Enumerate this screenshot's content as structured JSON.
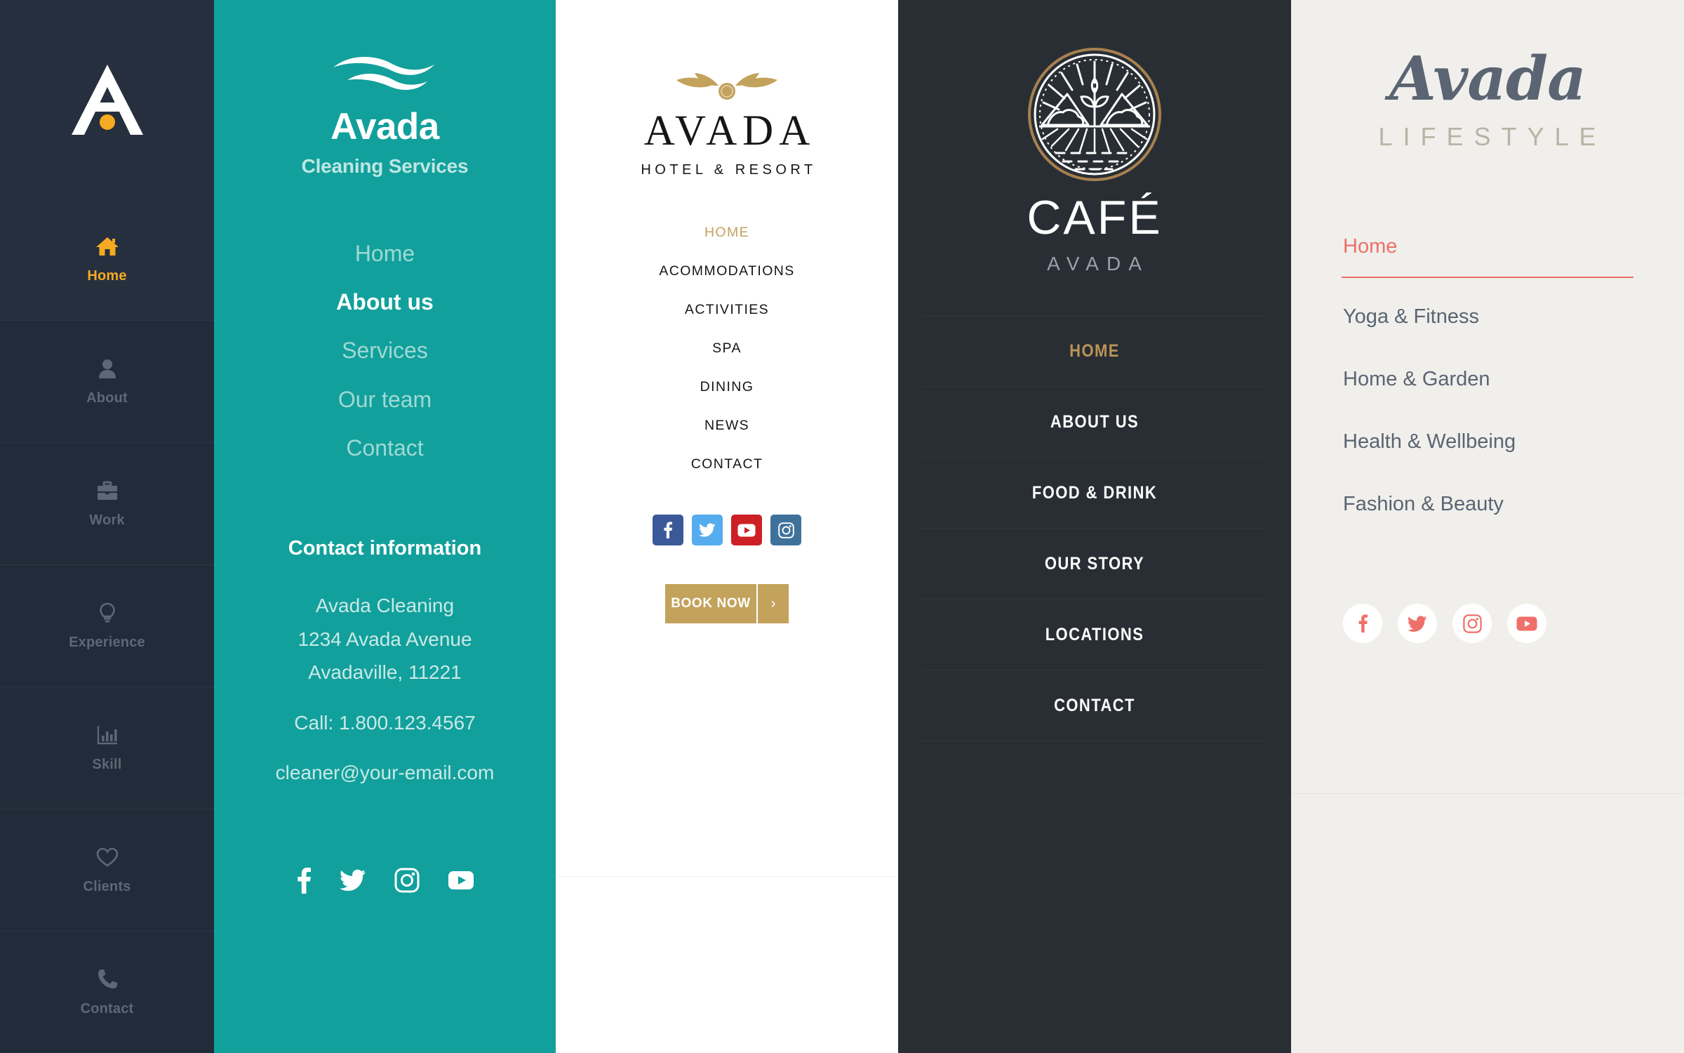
{
  "classic": {
    "logo_letter": "A",
    "items": [
      {
        "label": "Home",
        "icon": "home-icon",
        "active": true
      },
      {
        "label": "About",
        "icon": "person-icon",
        "active": false
      },
      {
        "label": "Work",
        "icon": "briefcase-icon",
        "active": false
      },
      {
        "label": "Experience",
        "icon": "bulb-icon",
        "active": false
      },
      {
        "label": "Skill",
        "icon": "bar-chart-icon",
        "active": false
      },
      {
        "label": "Clients",
        "icon": "heart-icon",
        "active": false
      },
      {
        "label": "Contact",
        "icon": "phone-icon",
        "active": false
      }
    ],
    "colors": {
      "background": "#242d3c",
      "active_text": "#f5ab21",
      "inactive_text": "#5d6775"
    }
  },
  "cleaning": {
    "logo": {
      "name": "Avada",
      "subtitle": "Cleaning Services",
      "mark": "wave-icon"
    },
    "nav": [
      {
        "label": "Home",
        "active": false
      },
      {
        "label": "About us",
        "active": true
      },
      {
        "label": "Services",
        "active": false
      },
      {
        "label": "Our team",
        "active": false
      },
      {
        "label": "Contact",
        "active": false
      }
    ],
    "contact": {
      "title": "Contact information",
      "company": "Avada Cleaning",
      "street": "1234 Avada Avenue",
      "city": "Avadaville, 11221",
      "phone": "Call: 1.800.123.4567",
      "email": "cleaner@your-email.com"
    },
    "social": [
      "facebook-icon",
      "twitter-icon",
      "instagram-icon",
      "youtube-icon"
    ],
    "colors": {
      "background": "#12a09c",
      "active_text": "#ffffff",
      "inactive_text": "#9fd9d4"
    }
  },
  "hotel": {
    "logo": {
      "name": "AVADA",
      "subtitle": "HOTEL & RESORT",
      "mark": "olive-branch-icon"
    },
    "nav": [
      {
        "label": "HOME",
        "active": true
      },
      {
        "label": "ACOMMODATIONS",
        "active": false
      },
      {
        "label": "ACTIVITIES",
        "active": false
      },
      {
        "label": "SPA",
        "active": false
      },
      {
        "label": "DINING",
        "active": false
      },
      {
        "label": "NEWS",
        "active": false
      },
      {
        "label": "CONTACT",
        "active": false
      }
    ],
    "social": [
      {
        "icon": "facebook-icon",
        "color": "#3b5998"
      },
      {
        "icon": "twitter-icon",
        "color": "#55acee"
      },
      {
        "icon": "youtube-icon",
        "color": "#cd2026"
      },
      {
        "icon": "instagram-icon",
        "color": "#3f729b"
      }
    ],
    "book_button": {
      "label": "BOOK NOW",
      "arrow": "›"
    },
    "colors": {
      "background": "#ffffff",
      "accent": "#c3a25c",
      "text": "#16161a"
    }
  },
  "cafe": {
    "logo": {
      "name": "CAFÉ",
      "subtitle": "AVADA",
      "mark": "farm-badge-icon"
    },
    "nav": [
      {
        "label": "HOME",
        "active": true
      },
      {
        "label": "ABOUT US",
        "active": false
      },
      {
        "label": "FOOD & DRINK",
        "active": false
      },
      {
        "label": "OUR STORY",
        "active": false
      },
      {
        "label": "LOCATIONS",
        "active": false
      },
      {
        "label": "CONTACT",
        "active": false
      }
    ],
    "colors": {
      "background": "#292e34",
      "accent": "#bb9459",
      "text": "#ffffff"
    }
  },
  "lifestyle": {
    "logo": {
      "name": "Avada",
      "subtitle": "LIFESTYLE"
    },
    "nav": [
      {
        "label": "Home",
        "active": true
      },
      {
        "label": "Yoga & Fitness",
        "active": false
      },
      {
        "label": "Home & Garden",
        "active": false
      },
      {
        "label": "Health & Wellbeing",
        "active": false
      },
      {
        "label": "Fashion & Beauty",
        "active": false
      }
    ],
    "social": [
      "facebook-icon",
      "twitter-icon",
      "instagram-icon",
      "youtube-icon"
    ],
    "colors": {
      "background": "#f0efeb",
      "accent": "#ef6f6a",
      "text": "#5b6472",
      "subtitle": "#b8b4a5"
    }
  }
}
